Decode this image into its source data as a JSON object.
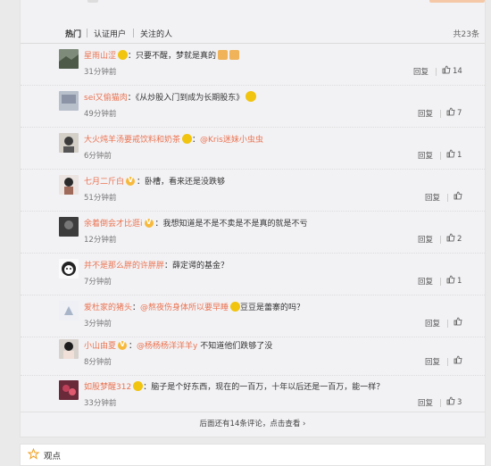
{
  "tabs": {
    "hot": "热门",
    "verified": "认证用户",
    "following": "关注的人",
    "total": "共23条"
  },
  "actions": {
    "reply": "回复"
  },
  "comments": [
    {
      "user": "星雨山涩",
      "badge": "red-face-icon",
      "text": "：只要不醒，梦就是真的",
      "time": "31分钟前",
      "likes": "14"
    },
    {
      "user": "sei又偷猫肉",
      "text": "：《从炒股入门到成为长期股东》",
      "time": "49分钟前",
      "likes": "7"
    },
    {
      "user": "大火炖羊汤要戒饮料和奶茶",
      "badge": "red-face-icon",
      "mention": "@Kris迷妹小虫虫",
      "text": "",
      "time": "6分钟前",
      "likes": "1"
    },
    {
      "user": "七月二斤白",
      "badge": "vip-v-icon",
      "text": "：卧槽，看来还是没跌够",
      "time": "51分钟前",
      "likes": ""
    },
    {
      "user": "余着倒会才比逛i",
      "badge": "vip-v-icon",
      "text": "：我想知道是不是不卖是不是真的就是不亏",
      "time": "12分钟前",
      "likes": "2"
    },
    {
      "user": "并不是那么胖的许胖胖",
      "text": "：薛定谔的基金？",
      "time": "7分钟前",
      "likes": "1"
    },
    {
      "user": "爱杜家的猪头",
      "text": "：",
      "mention": "@熬夜伤身体所以要早睡",
      "text2": "豆豆是蕾寨的吗？",
      "time": "3分钟前",
      "likes": ""
    },
    {
      "user": "小山由夏",
      "badge": "vip-v-icon",
      "mention": "@杨杨杨洋洋羊y",
      "text": "不知道他们跌够了没",
      "time": "8分钟前",
      "likes": ""
    },
    {
      "user": "如股梦醒312",
      "badge": "red-face-icon",
      "text": "：脑子是个好东西，现在的一百万，十年以后还是一百万，能一样？",
      "time": "33分钟前",
      "likes": "3"
    }
  ],
  "more": "后面还有14条评论，点击查看 ›",
  "footer": {
    "label": "观点"
  },
  "colors": {
    "accent": "#eb7350",
    "background": "#f2f2f5"
  }
}
